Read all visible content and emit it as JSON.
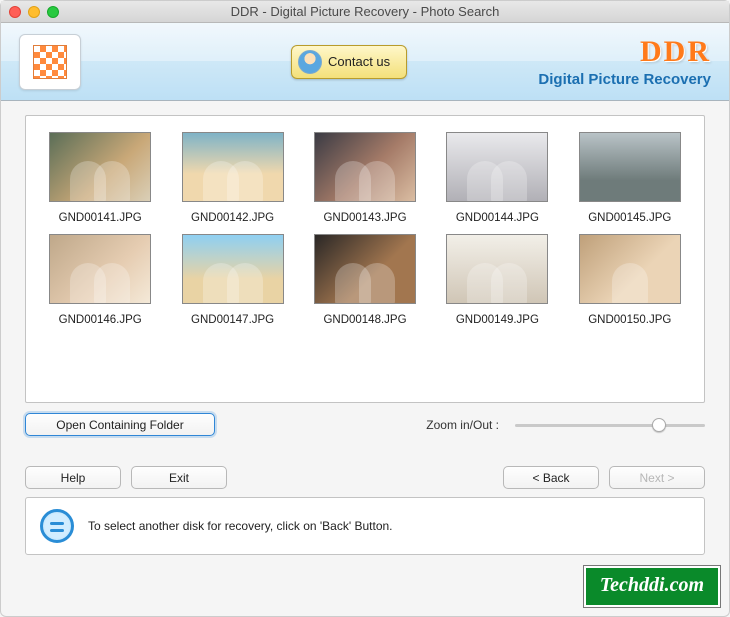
{
  "window": {
    "title": "DDR - Digital Picture Recovery - Photo Search"
  },
  "header": {
    "contact_label": "Contact us",
    "brand_top": "DDR",
    "brand_sub": "Digital Picture Recovery"
  },
  "thumbnails": [
    {
      "file": "GND00141.JPG"
    },
    {
      "file": "GND00142.JPG"
    },
    {
      "file": "GND00143.JPG"
    },
    {
      "file": "GND00144.JPG"
    },
    {
      "file": "GND00145.JPG"
    },
    {
      "file": "GND00146.JPG"
    },
    {
      "file": "GND00147.JPG"
    },
    {
      "file": "GND00148.JPG"
    },
    {
      "file": "GND00149.JPG"
    },
    {
      "file": "GND00150.JPG"
    }
  ],
  "controls": {
    "open_folder": "Open Containing Folder",
    "zoom_label": "Zoom in/Out :"
  },
  "nav": {
    "help": "Help",
    "exit": "Exit",
    "back": "< Back",
    "next": "Next >"
  },
  "info": {
    "text": "To select another disk for recovery, click on 'Back' Button."
  },
  "watermark": "Techddi.com"
}
